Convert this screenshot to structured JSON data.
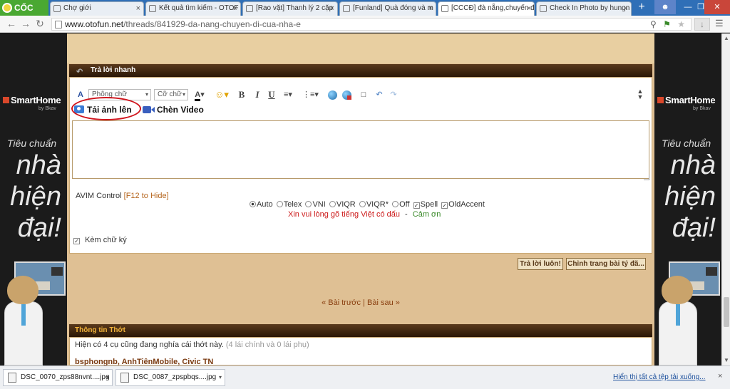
{
  "browser": {
    "brand": "CỐC CỐC",
    "tabs": [
      {
        "title": "Chợ giới"
      },
      {
        "title": "Kết quả tìm kiếm - OTOF"
      },
      {
        "title": "[Rao vặt] Thanh lý 2 cặp"
      },
      {
        "title": "[Funland] Quà đóng và m"
      },
      {
        "title": "[CCCĐ] đà nẵng,chuyến đ"
      },
      {
        "title": "Check In Photo by hungn"
      }
    ],
    "new_tab": "+",
    "close_glyph": "×",
    "url_host": "www.otofun.net",
    "url_path": "/threads/841929-da-nang-chuyen-di-cua-nha-e"
  },
  "quick_reply": {
    "header": "Trả lời nhanh",
    "font_select": "Phông chữ",
    "size_select": "Cỡ chữ",
    "upload_label": "Tải ảnh lên",
    "video_label": "Chèn Video",
    "editor_value": "",
    "avim_title": "AVIM Control",
    "avim_hint": "[F12 to Hide]",
    "avim_modes": [
      {
        "label": "Auto",
        "kind": "radio",
        "checked": true
      },
      {
        "label": "Telex",
        "kind": "radio",
        "checked": false
      },
      {
        "label": "VNI",
        "kind": "radio",
        "checked": false
      },
      {
        "label": "VIQR",
        "kind": "radio",
        "checked": false
      },
      {
        "label": "VIQR*",
        "kind": "radio",
        "checked": false
      },
      {
        "label": "Off",
        "kind": "radio",
        "checked": false
      },
      {
        "label": "Spell",
        "kind": "check",
        "checked": true
      },
      {
        "label": "OldAccent",
        "kind": "check",
        "checked": true
      }
    ],
    "avim_msg_red": "Xin vui lòng gõ tiếng Việt có dấu",
    "avim_msg_sep": "-",
    "avim_msg_green": "Cảm ơn",
    "signature_label": "Kèm chữ ký",
    "submit_label": "Trả lời luôn!",
    "advanced_label": "Chỉnh trang bài tý đã..."
  },
  "pager": {
    "prev": "« Bài trước",
    "sep": "|",
    "next": "Bài sau »"
  },
  "thread_info": {
    "header": "Thông tin Thớt",
    "text": "Hiện có 4 cụ cũng đang nghía cái thớt này.",
    "detail": "(4 lái chính và 0 lái phụ)",
    "users": "bsphongnb, AnhTiênMobile, Civic TN"
  },
  "ads": {
    "brand": "SmartHome",
    "by": "by Bkav",
    "slogan_small": "Tiêu chuẩn",
    "slogan_big": "nhà hiện đại!"
  },
  "downloads": {
    "items": [
      {
        "name": "DSC_0070_zps88nvnt....jpg"
      },
      {
        "name": "DSC_0087_zpspbqs....jpg"
      }
    ],
    "show_all": "Hiển thị tất cả tệp tải xuống...",
    "close": "×"
  },
  "colors": {
    "forum_bg": "#dfc094",
    "header_bg": "#3a220d",
    "highlight_circle": "#d0141c",
    "tabbar": "#2f6fb7"
  }
}
